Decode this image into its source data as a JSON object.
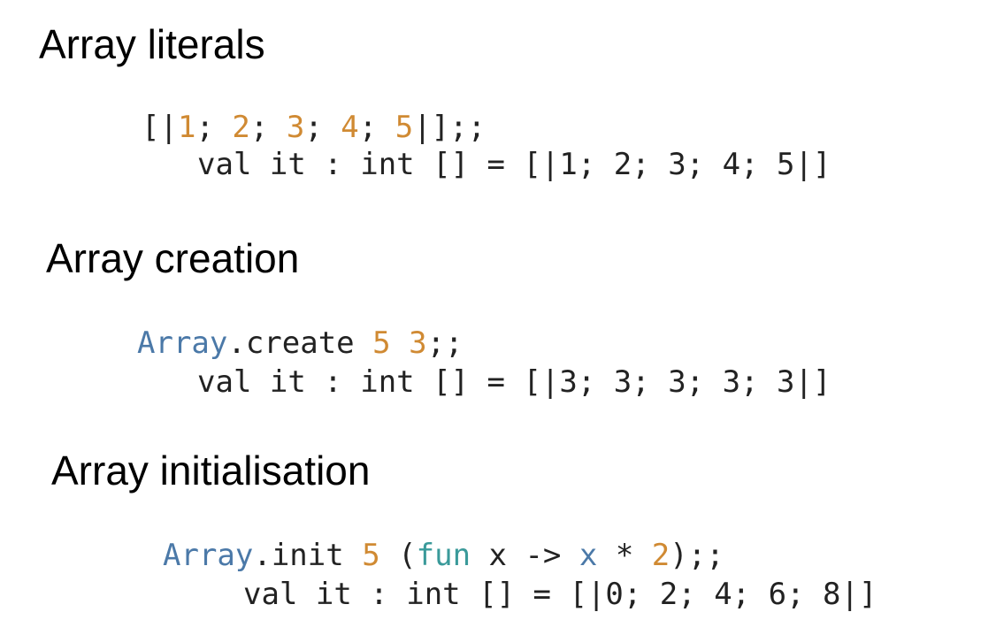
{
  "sections": [
    {
      "heading": "Array literals",
      "input": {
        "open": "[|",
        "n1": "1",
        "sep1": "; ",
        "n2": "2",
        "sep2": "; ",
        "n3": "3",
        "sep3": "; ",
        "n4": "4",
        "sep4": "; ",
        "n5": "5",
        "close": "|];;"
      },
      "output": "val it : int [] = [|1; 2; 3; 4; 5|]"
    },
    {
      "heading": "Array creation",
      "input": {
        "module": "Array",
        "func": ".create ",
        "arg1": "5",
        "space": " ",
        "arg2": "3",
        "end": ";;"
      },
      "output": "val it : int [] = [|3; 3; 3; 3; 3|]"
    },
    {
      "heading": "Array initialisation",
      "input": {
        "module": "Array",
        "func": ".init ",
        "arg1": "5",
        "paren_open": " (",
        "keyword": "fun",
        "param": " x -> ",
        "var": "x",
        "op": " * ",
        "arg2": "2",
        "end": ");;"
      },
      "output": "val it : int [] = [|0; 2; 4; 6; 8|]"
    }
  ],
  "colors": {
    "number": "#d08a33",
    "module": "#4b79a8",
    "keyword": "#3a9a9a",
    "text": "#222222"
  }
}
